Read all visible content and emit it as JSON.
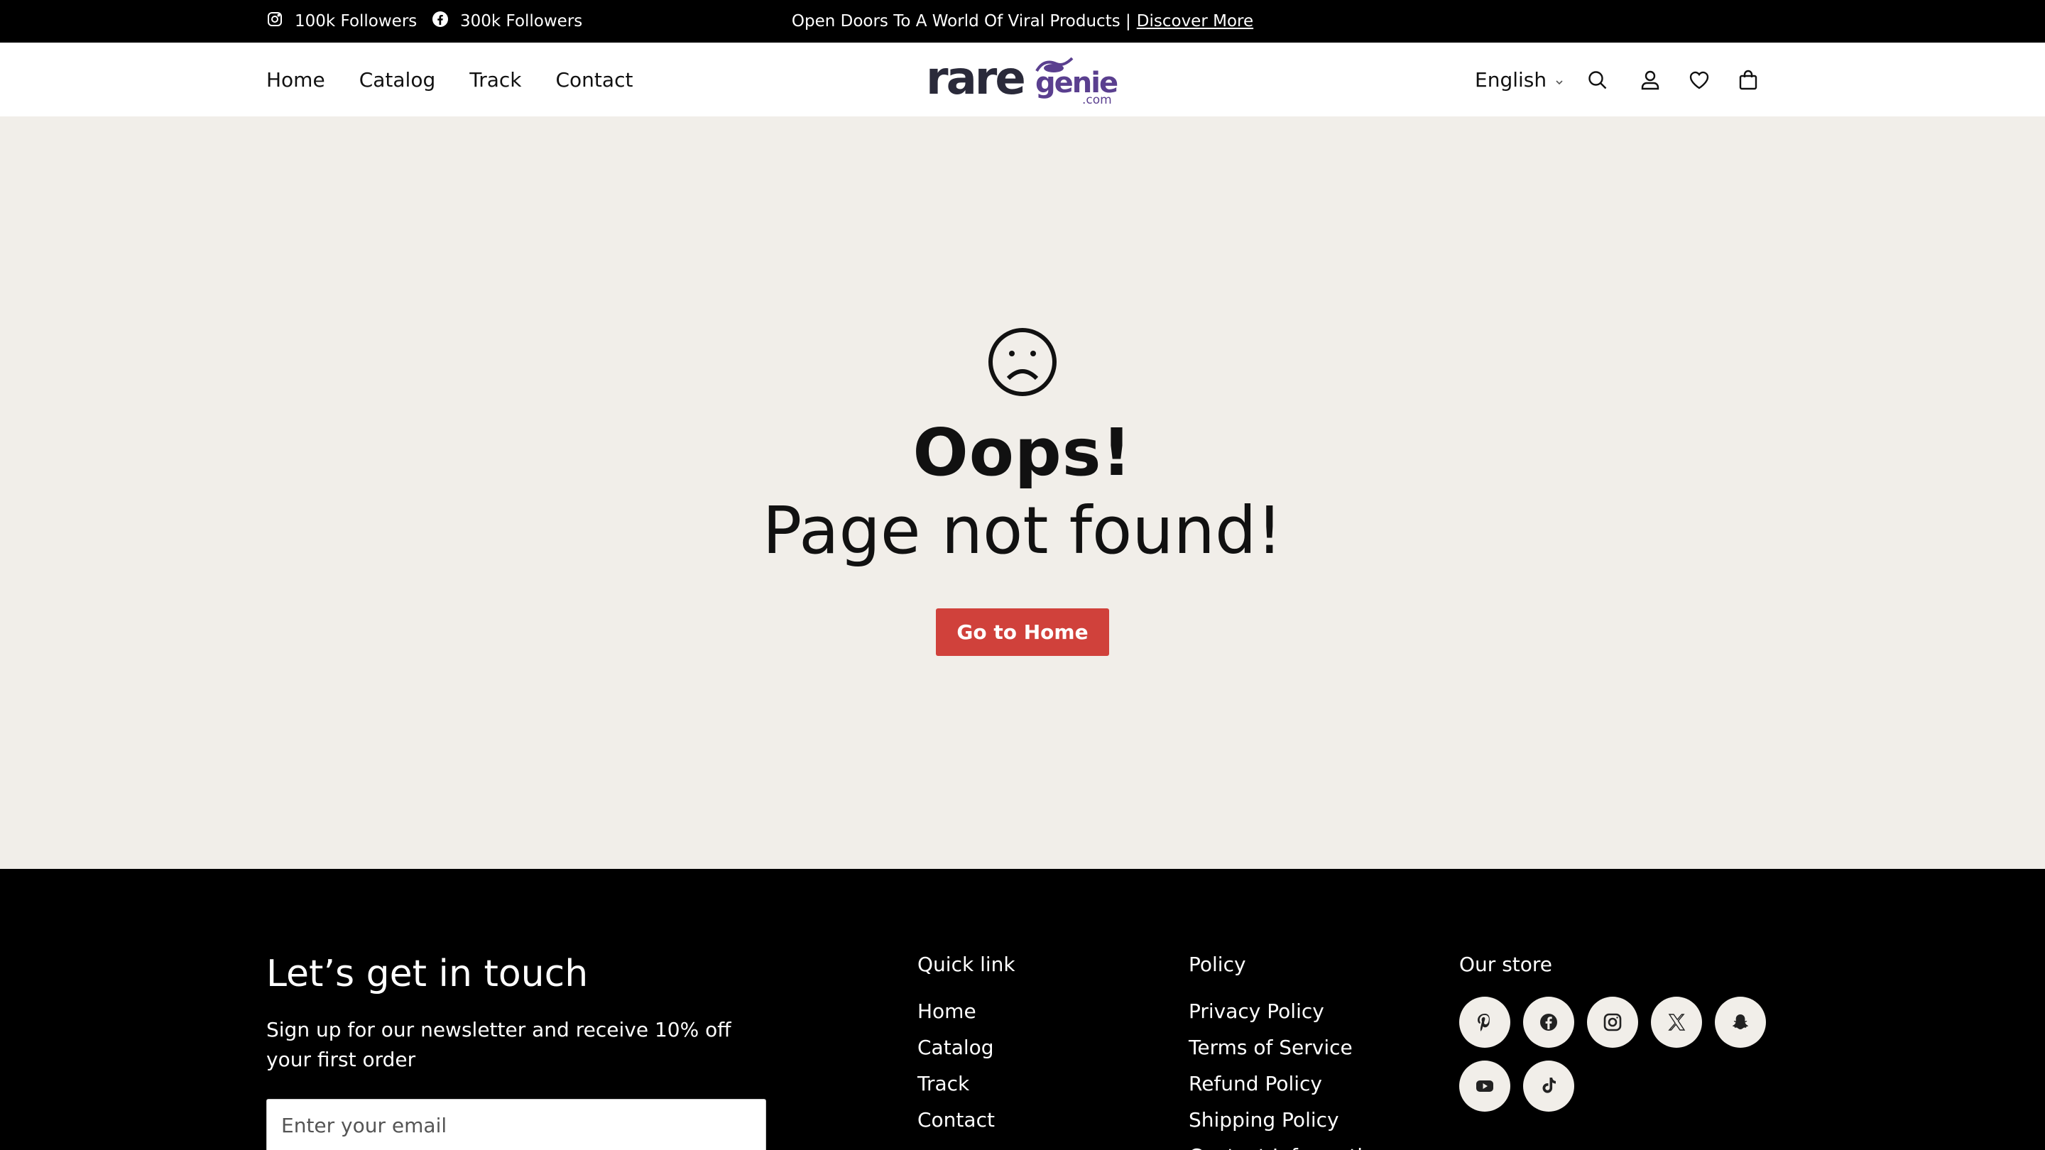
{
  "topbar": {
    "instagram_followers": "100k Followers",
    "facebook_followers": "300k Followers",
    "announcement": "Open Doors To A World Of Viral Products |",
    "announcement_link": "Discover More"
  },
  "header": {
    "nav": [
      "Home",
      "Catalog",
      "Track",
      "Contact"
    ],
    "logo_text": "raregenie",
    "logo_sub": ".com",
    "language": "English",
    "icons": [
      "search-icon",
      "account-icon",
      "wishlist-icon",
      "cart-icon"
    ]
  },
  "main": {
    "emoji": "sad-face-icon",
    "title": "Oops!",
    "subtitle": "Page not found!",
    "button_label": "Go to Home"
  },
  "footer": {
    "touch_title": "Let’s get in touch",
    "touch_text": "Sign up for our newsletter and receive 10% off your first order",
    "email_placeholder": "Enter your email",
    "quick_link": {
      "heading": "Quick link",
      "items": [
        "Home",
        "Catalog",
        "Track",
        "Contact"
      ]
    },
    "policy": {
      "heading": "Policy",
      "items": [
        "Privacy Policy",
        "Terms of Service",
        "Refund Policy",
        "Shipping Policy",
        "Contact Information"
      ]
    },
    "store": {
      "heading": "Our store",
      "socials": [
        "pinterest-icon",
        "facebook-icon",
        "instagram-icon",
        "x-icon",
        "snapchat-icon",
        "youtube-icon",
        "tiktok-icon"
      ]
    }
  },
  "colors": {
    "topbar_bg": "#000000",
    "page_bg": "#f1eee9",
    "button_bg": "#d0413b",
    "logo_purple": "#5a3f8f",
    "logo_dark": "#2a2a3a"
  }
}
